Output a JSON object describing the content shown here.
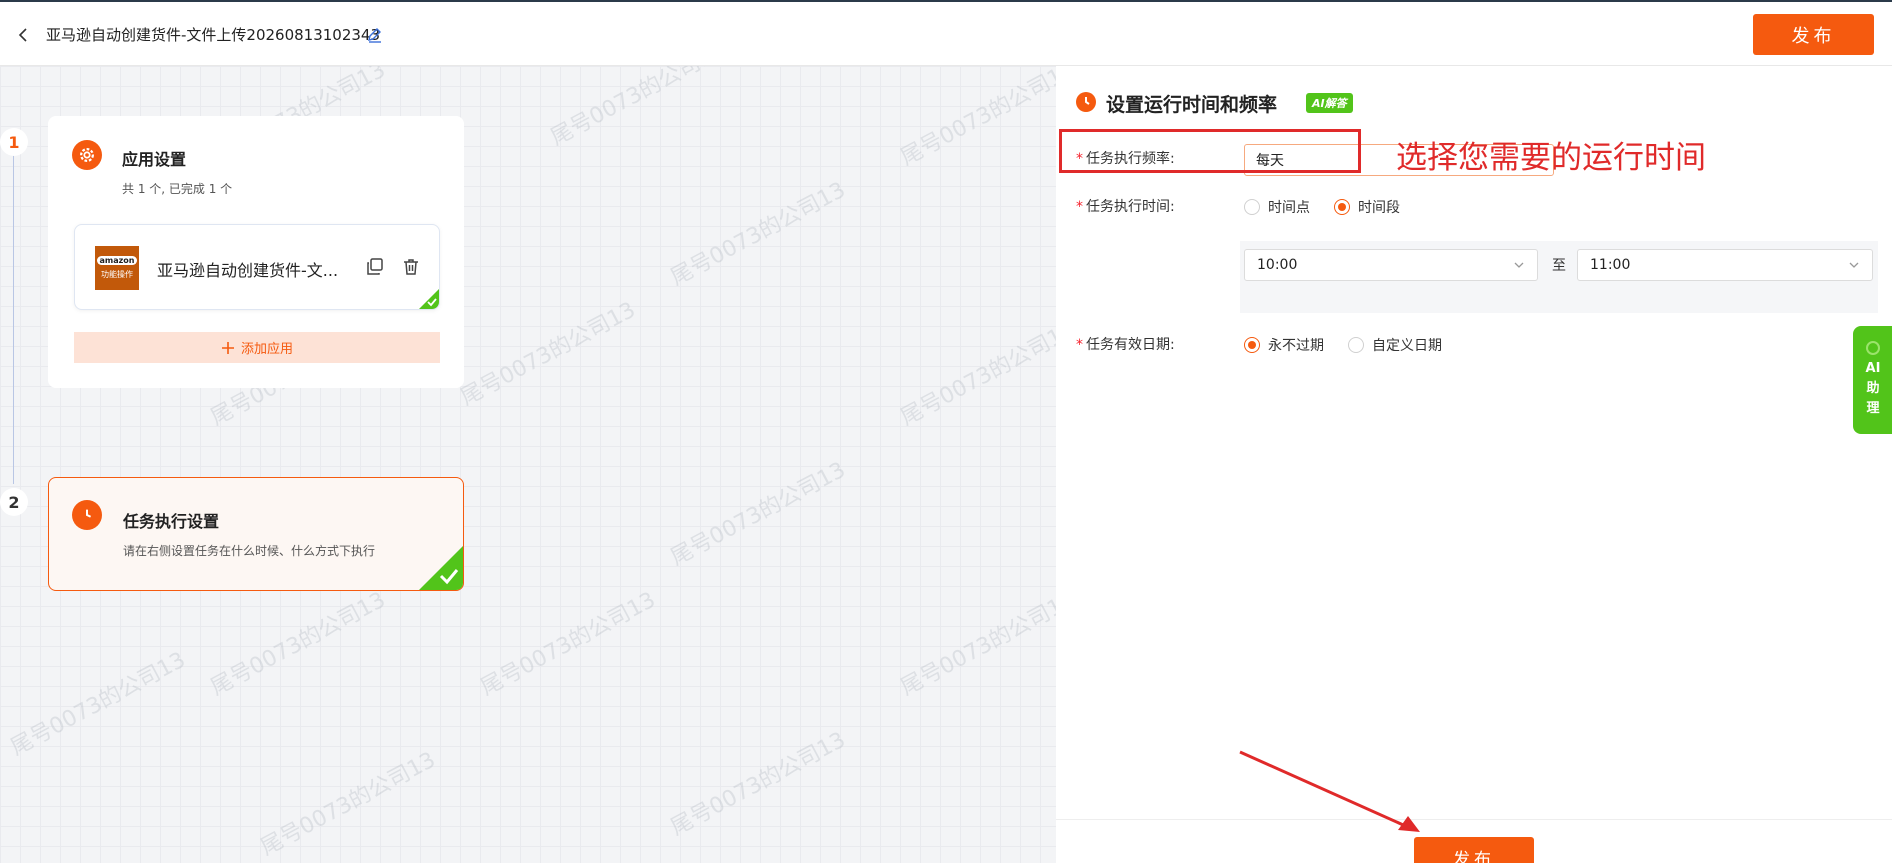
{
  "header": {
    "title": "亚马逊自动创建货件-文件上传20260813102343",
    "publish_label": "发布"
  },
  "watermark": "尾号0073的公司13",
  "steps": [
    {
      "number": "1"
    },
    {
      "number": "2"
    }
  ],
  "app_settings": {
    "title": "应用设置",
    "subtitle": "共 1 个, 已完成 1 个",
    "app_name": "亚马逊自动创建货件-文...",
    "logo_brand": "amazon",
    "logo_caption": "功能操作",
    "add_app_label": "添加应用"
  },
  "task_settings": {
    "title": "任务执行设置",
    "subtitle": "请在右侧设置任务在什么时候、什么方式下执行"
  },
  "panel": {
    "title": "设置运行时间和频率",
    "ai_tag": "AI解答",
    "frequency_label": "任务执行频率:",
    "frequency_value": "每天",
    "annotation": "选择您需要的运行时间",
    "time_label": "任务执行时间:",
    "time_options": [
      "时间点",
      "时间段"
    ],
    "start_time": "10:00",
    "to_label": "至",
    "end_time": "11:00",
    "validity_label": "任务有效日期:",
    "validity_options": [
      "永不过期",
      "自定义日期"
    ],
    "publish_label": "发布"
  },
  "ai_assistant": {
    "line1": "AI",
    "line2": "助",
    "line3": "理"
  },
  "colors": {
    "accent": "#f55a0f",
    "success": "#52c41a",
    "annotation": "#e02a2a"
  }
}
